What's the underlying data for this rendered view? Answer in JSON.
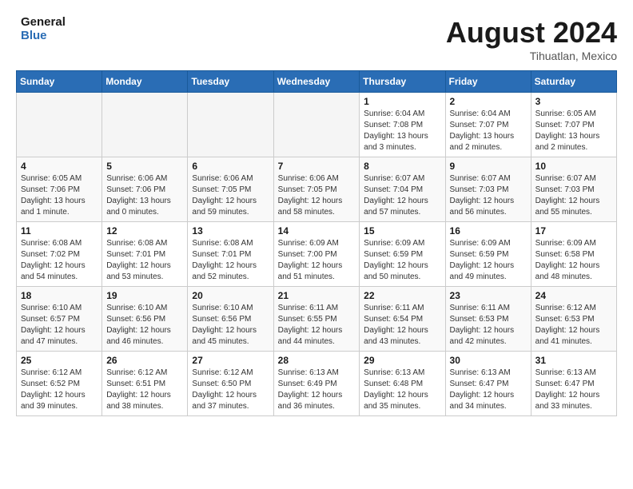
{
  "header": {
    "logo_line1": "General",
    "logo_line2": "Blue",
    "month": "August 2024",
    "location": "Tihuatlan, Mexico"
  },
  "weekdays": [
    "Sunday",
    "Monday",
    "Tuesday",
    "Wednesday",
    "Thursday",
    "Friday",
    "Saturday"
  ],
  "weeks": [
    [
      {
        "day": "",
        "empty": true
      },
      {
        "day": "",
        "empty": true
      },
      {
        "day": "",
        "empty": true
      },
      {
        "day": "",
        "empty": true
      },
      {
        "day": "1",
        "sunrise": "6:04 AM",
        "sunset": "7:08 PM",
        "daylight": "13 hours and 3 minutes."
      },
      {
        "day": "2",
        "sunrise": "6:04 AM",
        "sunset": "7:07 PM",
        "daylight": "13 hours and 2 minutes."
      },
      {
        "day": "3",
        "sunrise": "6:05 AM",
        "sunset": "7:07 PM",
        "daylight": "13 hours and 2 minutes."
      }
    ],
    [
      {
        "day": "4",
        "sunrise": "6:05 AM",
        "sunset": "7:06 PM",
        "daylight": "13 hours and 1 minute."
      },
      {
        "day": "5",
        "sunrise": "6:06 AM",
        "sunset": "7:06 PM",
        "daylight": "13 hours and 0 minutes."
      },
      {
        "day": "6",
        "sunrise": "6:06 AM",
        "sunset": "7:05 PM",
        "daylight": "12 hours and 59 minutes."
      },
      {
        "day": "7",
        "sunrise": "6:06 AM",
        "sunset": "7:05 PM",
        "daylight": "12 hours and 58 minutes."
      },
      {
        "day": "8",
        "sunrise": "6:07 AM",
        "sunset": "7:04 PM",
        "daylight": "12 hours and 57 minutes."
      },
      {
        "day": "9",
        "sunrise": "6:07 AM",
        "sunset": "7:03 PM",
        "daylight": "12 hours and 56 minutes."
      },
      {
        "day": "10",
        "sunrise": "6:07 AM",
        "sunset": "7:03 PM",
        "daylight": "12 hours and 55 minutes."
      }
    ],
    [
      {
        "day": "11",
        "sunrise": "6:08 AM",
        "sunset": "7:02 PM",
        "daylight": "12 hours and 54 minutes."
      },
      {
        "day": "12",
        "sunrise": "6:08 AM",
        "sunset": "7:01 PM",
        "daylight": "12 hours and 53 minutes."
      },
      {
        "day": "13",
        "sunrise": "6:08 AM",
        "sunset": "7:01 PM",
        "daylight": "12 hours and 52 minutes."
      },
      {
        "day": "14",
        "sunrise": "6:09 AM",
        "sunset": "7:00 PM",
        "daylight": "12 hours and 51 minutes."
      },
      {
        "day": "15",
        "sunrise": "6:09 AM",
        "sunset": "6:59 PM",
        "daylight": "12 hours and 50 minutes."
      },
      {
        "day": "16",
        "sunrise": "6:09 AM",
        "sunset": "6:59 PM",
        "daylight": "12 hours and 49 minutes."
      },
      {
        "day": "17",
        "sunrise": "6:09 AM",
        "sunset": "6:58 PM",
        "daylight": "12 hours and 48 minutes."
      }
    ],
    [
      {
        "day": "18",
        "sunrise": "6:10 AM",
        "sunset": "6:57 PM",
        "daylight": "12 hours and 47 minutes."
      },
      {
        "day": "19",
        "sunrise": "6:10 AM",
        "sunset": "6:56 PM",
        "daylight": "12 hours and 46 minutes."
      },
      {
        "day": "20",
        "sunrise": "6:10 AM",
        "sunset": "6:56 PM",
        "daylight": "12 hours and 45 minutes."
      },
      {
        "day": "21",
        "sunrise": "6:11 AM",
        "sunset": "6:55 PM",
        "daylight": "12 hours and 44 minutes."
      },
      {
        "day": "22",
        "sunrise": "6:11 AM",
        "sunset": "6:54 PM",
        "daylight": "12 hours and 43 minutes."
      },
      {
        "day": "23",
        "sunrise": "6:11 AM",
        "sunset": "6:53 PM",
        "daylight": "12 hours and 42 minutes."
      },
      {
        "day": "24",
        "sunrise": "6:12 AM",
        "sunset": "6:53 PM",
        "daylight": "12 hours and 41 minutes."
      }
    ],
    [
      {
        "day": "25",
        "sunrise": "6:12 AM",
        "sunset": "6:52 PM",
        "daylight": "12 hours and 39 minutes."
      },
      {
        "day": "26",
        "sunrise": "6:12 AM",
        "sunset": "6:51 PM",
        "daylight": "12 hours and 38 minutes."
      },
      {
        "day": "27",
        "sunrise": "6:12 AM",
        "sunset": "6:50 PM",
        "daylight": "12 hours and 37 minutes."
      },
      {
        "day": "28",
        "sunrise": "6:13 AM",
        "sunset": "6:49 PM",
        "daylight": "12 hours and 36 minutes."
      },
      {
        "day": "29",
        "sunrise": "6:13 AM",
        "sunset": "6:48 PM",
        "daylight": "12 hours and 35 minutes."
      },
      {
        "day": "30",
        "sunrise": "6:13 AM",
        "sunset": "6:47 PM",
        "daylight": "12 hours and 34 minutes."
      },
      {
        "day": "31",
        "sunrise": "6:13 AM",
        "sunset": "6:47 PM",
        "daylight": "12 hours and 33 minutes."
      }
    ]
  ],
  "labels": {
    "sunrise": "Sunrise:",
    "sunset": "Sunset:",
    "daylight": "Daylight:"
  }
}
